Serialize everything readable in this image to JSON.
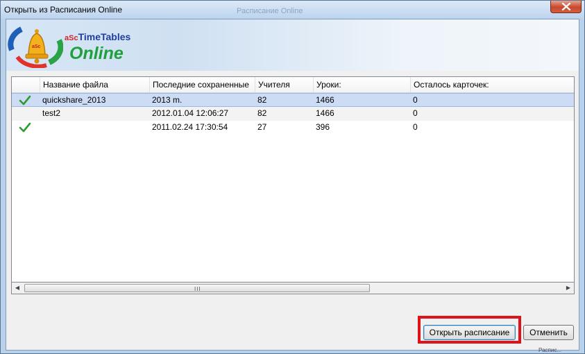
{
  "window": {
    "title": "Открыть из Расписания Online",
    "ghost_title": "Расписание Online",
    "close_icon": "close-x-icon"
  },
  "brand": {
    "asc": "aSc",
    "name": "TimeTables",
    "online": "Online",
    "logo_icon": "bell-arrows-logo",
    "logo_text": "aSc"
  },
  "table": {
    "columns": [
      "",
      "Название файла",
      "Последние сохраненные",
      "Учителя",
      "Уроки:",
      "Осталось карточек:"
    ],
    "rows": [
      {
        "saved": true,
        "name": "quickshare_2013",
        "last_saved": "2013 m.",
        "teachers": "82",
        "lessons": "1466",
        "cards_left": "0"
      },
      {
        "saved": false,
        "name": "test2",
        "last_saved": "2012.01.04 12:06:27",
        "teachers": "82",
        "lessons": "1466",
        "cards_left": "0"
      },
      {
        "saved": true,
        "name": "",
        "last_saved": "2011.02.24 17:30:54",
        "teachers": "27",
        "lessons": "396",
        "cards_left": "0"
      }
    ],
    "selected_row": 0
  },
  "scrollbar": {
    "left_arrow": "◀",
    "right_arrow": "▶",
    "grip": "III"
  },
  "buttons": {
    "open_label": "Открыть расписание",
    "cancel_label": "Отменить"
  },
  "colors": {
    "check": "#2f9a2f",
    "highlight_border": "#e01219",
    "brand_online": "#1fa03c"
  },
  "edge_text": "Распис..."
}
